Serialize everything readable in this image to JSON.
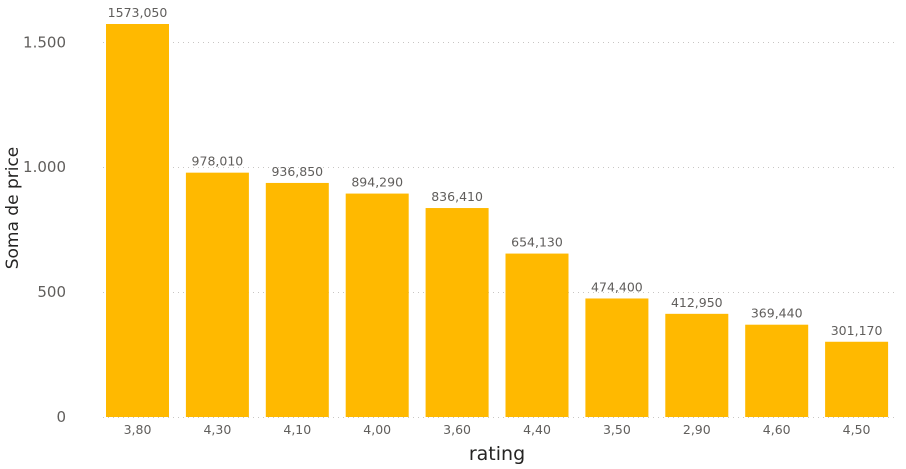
{
  "chart_data": {
    "type": "bar",
    "title": "",
    "xlabel": "rating",
    "ylabel": "Soma de price",
    "categories": [
      "3,80",
      "4,30",
      "4,10",
      "4,00",
      "3,60",
      "4,40",
      "3,50",
      "2,90",
      "4,60",
      "4,50"
    ],
    "values": [
      1573.05,
      978.01,
      936.85,
      894.29,
      836.41,
      654.13,
      474.4,
      412.95,
      369.44,
      301.17
    ],
    "data_labels": [
      "1573,050",
      "978,010",
      "936,850",
      "894,290",
      "836,410",
      "654,130",
      "474,400",
      "412,950",
      "369,440",
      "301,170"
    ],
    "y_ticks": [
      0,
      500,
      1000,
      1500
    ],
    "y_tick_labels": [
      "0",
      "500",
      "1.000",
      "1.500"
    ],
    "ylim": [
      0,
      1573.05
    ],
    "grid": true,
    "legend": "none",
    "bar_color": "#FFB900"
  }
}
